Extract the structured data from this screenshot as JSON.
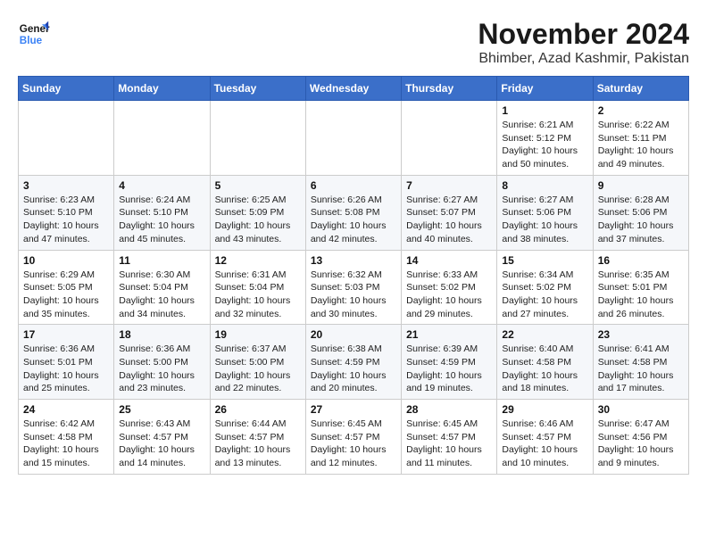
{
  "logo": {
    "line1": "General",
    "line2": "Blue"
  },
  "title": "November 2024",
  "location": "Bhimber, Azad Kashmir, Pakistan",
  "days_of_week": [
    "Sunday",
    "Monday",
    "Tuesday",
    "Wednesday",
    "Thursday",
    "Friday",
    "Saturday"
  ],
  "weeks": [
    [
      {
        "day": "",
        "info": ""
      },
      {
        "day": "",
        "info": ""
      },
      {
        "day": "",
        "info": ""
      },
      {
        "day": "",
        "info": ""
      },
      {
        "day": "",
        "info": ""
      },
      {
        "day": "1",
        "info": "Sunrise: 6:21 AM\nSunset: 5:12 PM\nDaylight: 10 hours\nand 50 minutes."
      },
      {
        "day": "2",
        "info": "Sunrise: 6:22 AM\nSunset: 5:11 PM\nDaylight: 10 hours\nand 49 minutes."
      }
    ],
    [
      {
        "day": "3",
        "info": "Sunrise: 6:23 AM\nSunset: 5:10 PM\nDaylight: 10 hours\nand 47 minutes."
      },
      {
        "day": "4",
        "info": "Sunrise: 6:24 AM\nSunset: 5:10 PM\nDaylight: 10 hours\nand 45 minutes."
      },
      {
        "day": "5",
        "info": "Sunrise: 6:25 AM\nSunset: 5:09 PM\nDaylight: 10 hours\nand 43 minutes."
      },
      {
        "day": "6",
        "info": "Sunrise: 6:26 AM\nSunset: 5:08 PM\nDaylight: 10 hours\nand 42 minutes."
      },
      {
        "day": "7",
        "info": "Sunrise: 6:27 AM\nSunset: 5:07 PM\nDaylight: 10 hours\nand 40 minutes."
      },
      {
        "day": "8",
        "info": "Sunrise: 6:27 AM\nSunset: 5:06 PM\nDaylight: 10 hours\nand 38 minutes."
      },
      {
        "day": "9",
        "info": "Sunrise: 6:28 AM\nSunset: 5:06 PM\nDaylight: 10 hours\nand 37 minutes."
      }
    ],
    [
      {
        "day": "10",
        "info": "Sunrise: 6:29 AM\nSunset: 5:05 PM\nDaylight: 10 hours\nand 35 minutes."
      },
      {
        "day": "11",
        "info": "Sunrise: 6:30 AM\nSunset: 5:04 PM\nDaylight: 10 hours\nand 34 minutes."
      },
      {
        "day": "12",
        "info": "Sunrise: 6:31 AM\nSunset: 5:04 PM\nDaylight: 10 hours\nand 32 minutes."
      },
      {
        "day": "13",
        "info": "Sunrise: 6:32 AM\nSunset: 5:03 PM\nDaylight: 10 hours\nand 30 minutes."
      },
      {
        "day": "14",
        "info": "Sunrise: 6:33 AM\nSunset: 5:02 PM\nDaylight: 10 hours\nand 29 minutes."
      },
      {
        "day": "15",
        "info": "Sunrise: 6:34 AM\nSunset: 5:02 PM\nDaylight: 10 hours\nand 27 minutes."
      },
      {
        "day": "16",
        "info": "Sunrise: 6:35 AM\nSunset: 5:01 PM\nDaylight: 10 hours\nand 26 minutes."
      }
    ],
    [
      {
        "day": "17",
        "info": "Sunrise: 6:36 AM\nSunset: 5:01 PM\nDaylight: 10 hours\nand 25 minutes."
      },
      {
        "day": "18",
        "info": "Sunrise: 6:36 AM\nSunset: 5:00 PM\nDaylight: 10 hours\nand 23 minutes."
      },
      {
        "day": "19",
        "info": "Sunrise: 6:37 AM\nSunset: 5:00 PM\nDaylight: 10 hours\nand 22 minutes."
      },
      {
        "day": "20",
        "info": "Sunrise: 6:38 AM\nSunset: 4:59 PM\nDaylight: 10 hours\nand 20 minutes."
      },
      {
        "day": "21",
        "info": "Sunrise: 6:39 AM\nSunset: 4:59 PM\nDaylight: 10 hours\nand 19 minutes."
      },
      {
        "day": "22",
        "info": "Sunrise: 6:40 AM\nSunset: 4:58 PM\nDaylight: 10 hours\nand 18 minutes."
      },
      {
        "day": "23",
        "info": "Sunrise: 6:41 AM\nSunset: 4:58 PM\nDaylight: 10 hours\nand 17 minutes."
      }
    ],
    [
      {
        "day": "24",
        "info": "Sunrise: 6:42 AM\nSunset: 4:58 PM\nDaylight: 10 hours\nand 15 minutes."
      },
      {
        "day": "25",
        "info": "Sunrise: 6:43 AM\nSunset: 4:57 PM\nDaylight: 10 hours\nand 14 minutes."
      },
      {
        "day": "26",
        "info": "Sunrise: 6:44 AM\nSunset: 4:57 PM\nDaylight: 10 hours\nand 13 minutes."
      },
      {
        "day": "27",
        "info": "Sunrise: 6:45 AM\nSunset: 4:57 PM\nDaylight: 10 hours\nand 12 minutes."
      },
      {
        "day": "28",
        "info": "Sunrise: 6:45 AM\nSunset: 4:57 PM\nDaylight: 10 hours\nand 11 minutes."
      },
      {
        "day": "29",
        "info": "Sunrise: 6:46 AM\nSunset: 4:57 PM\nDaylight: 10 hours\nand 10 minutes."
      },
      {
        "day": "30",
        "info": "Sunrise: 6:47 AM\nSunset: 4:56 PM\nDaylight: 10 hours\nand 9 minutes."
      }
    ]
  ]
}
